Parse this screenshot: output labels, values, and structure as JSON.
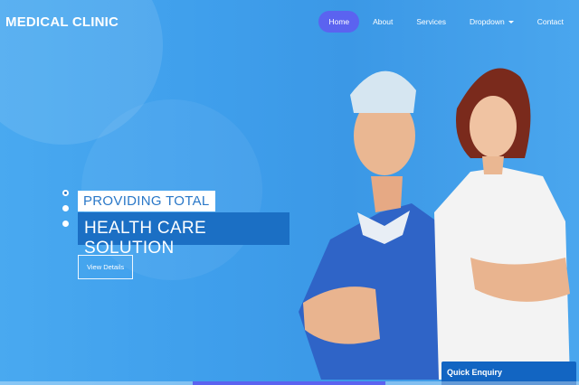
{
  "brand": "MEDICAL CLINIC",
  "nav": {
    "items": [
      {
        "label": "Home",
        "active": true
      },
      {
        "label": "About"
      },
      {
        "label": "Services"
      },
      {
        "label": "Dropdown",
        "caret": true
      },
      {
        "label": "Contact"
      }
    ]
  },
  "hero": {
    "line1": "PROVIDING TOTAL",
    "line2": "HEALTH CARE SOLUTION",
    "button": "View Details"
  },
  "enquiry": {
    "label": "Quick Enquiry"
  },
  "colors": {
    "accent": "#5b63f0",
    "primary": "#1b6fc4",
    "background": "#3a9be8"
  }
}
